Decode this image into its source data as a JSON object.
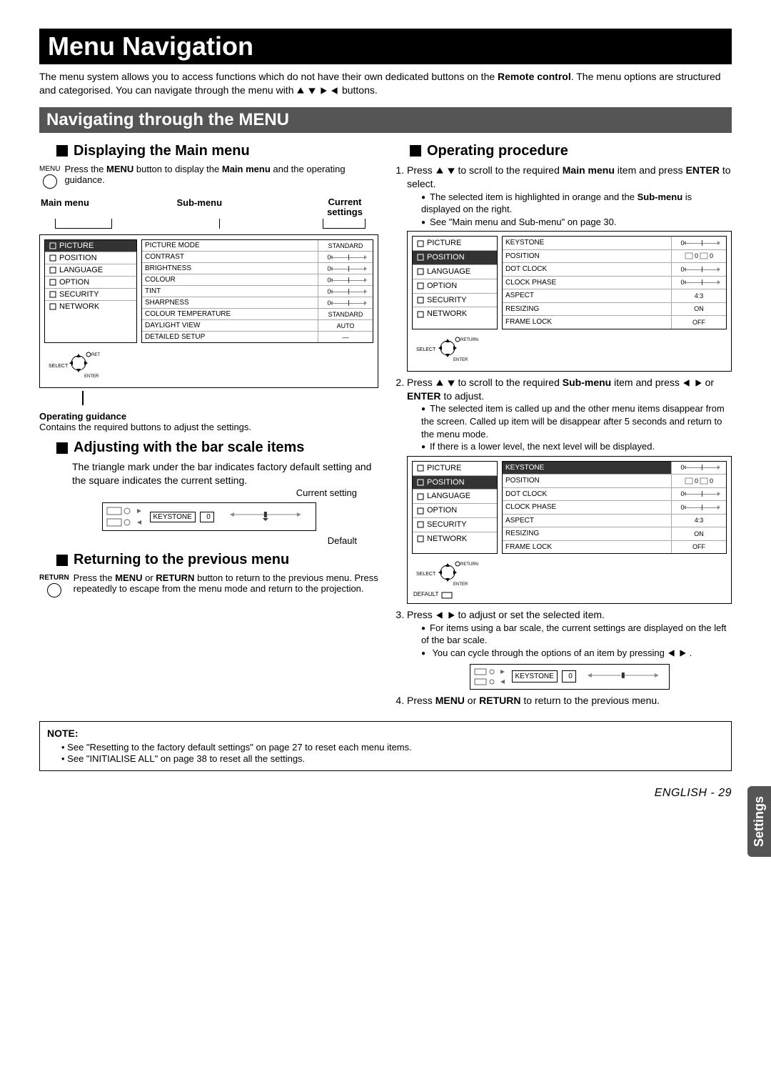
{
  "page": {
    "title": "Menu Navigation",
    "intro_part1": "The menu system allows you to access functions which do not have their own dedicated buttons on the ",
    "intro_bold1": "Remote control",
    "intro_part2": ". The menu options are structured and categorised. You can navigate through the menu with ",
    "intro_part3": " buttons.",
    "side_tab": "Settings",
    "footer": "ENGLISH - 29"
  },
  "section_bar": "Navigating through the MENU",
  "left": {
    "h_display": "Displaying the Main menu",
    "menu_btn_label": "MENU",
    "display_text_1": "Press the ",
    "display_bold_1": "MENU",
    "display_text_2": " button to display the ",
    "display_bold_2": "Main menu",
    "display_text_3": " and the operating guidance.",
    "labels": {
      "main_menu": "Main menu",
      "sub_menu": "Sub-menu",
      "current_settings": "Current settings"
    },
    "main_items": [
      "PICTURE",
      "POSITION",
      "LANGUAGE",
      "OPTION",
      "SECURITY",
      "NETWORK"
    ],
    "sub_items": [
      {
        "name": "PICTURE MODE",
        "val": "STANDARD",
        "type": "text"
      },
      {
        "name": "CONTRAST",
        "val": "0",
        "type": "bar"
      },
      {
        "name": "BRIGHTNESS",
        "val": "0",
        "type": "bar"
      },
      {
        "name": "COLOUR",
        "val": "0",
        "type": "bar"
      },
      {
        "name": "TINT",
        "val": "0",
        "type": "bar"
      },
      {
        "name": "SHARPNESS",
        "val": "0",
        "type": "bar"
      },
      {
        "name": "COLOUR TEMPERATURE",
        "val": "STANDARD",
        "type": "text"
      },
      {
        "name": "DAYLIGHT VIEW",
        "val": "AUTO",
        "type": "text"
      },
      {
        "name": "DETAILED SETUP",
        "val": "—",
        "type": "text"
      }
    ],
    "ctrl": {
      "select": "SELECT",
      "return": "RETURN",
      "enter": "ENTER"
    },
    "op_guidance_label": "Operating guidance",
    "op_guidance_text": "Contains the required buttons to adjust the settings.",
    "h_adjust": "Adjusting with the bar scale items",
    "adjust_text": "The triangle mark under the bar indicates factory default setting and the square indicates the current setting.",
    "current_setting_caption": "Current setting",
    "default_caption": "Default",
    "keystone_label": "KEYSTONE",
    "keystone_val": "0",
    "h_return": "Returning to the previous menu",
    "return_btn_label": "RETURN",
    "return_text_1": "Press the ",
    "return_bold_1": "MENU",
    "return_text_2": " or ",
    "return_bold_2": "RETURN",
    "return_text_3": " button to return to the previous menu. Press repeatedly to escape from the menu mode and return to the projection."
  },
  "right": {
    "h_op": "Operating procedure",
    "step1_a": "Press ",
    "step1_b": " to scroll to the required ",
    "step1_bold": "Main menu",
    "step1_c": " item and press ",
    "step1_bold2": "ENTER",
    "step1_d": " to select.",
    "step1_bul1_a": "The selected item is highlighted in orange and the ",
    "step1_bul1_bold": "Sub-menu",
    "step1_bul1_b": " is displayed on the right.",
    "step1_bul2": "See \"Main menu and Sub-menu\" on page 30.",
    "fig_main_items": [
      "PICTURE",
      "POSITION",
      "LANGUAGE",
      "OPTION",
      "SECURITY",
      "NETWORK"
    ],
    "fig_selected": "POSITION",
    "fig_sub_items": [
      {
        "name": "KEYSTONE",
        "val": "0",
        "type": "bar"
      },
      {
        "name": "POSITION",
        "val": "0",
        "type": "pos"
      },
      {
        "name": "DOT CLOCK",
        "val": "0",
        "type": "bar"
      },
      {
        "name": "CLOCK PHASE",
        "val": "0",
        "type": "bar"
      },
      {
        "name": "ASPECT",
        "val": "4:3",
        "type": "text"
      },
      {
        "name": "RESIZING",
        "val": "ON",
        "type": "text"
      },
      {
        "name": "FRAME LOCK",
        "val": "OFF",
        "type": "text"
      }
    ],
    "step2_a": "Press ",
    "step2_b": " to scroll to the required ",
    "step2_bold": "Sub-menu",
    "step2_c": " item and press ",
    "step2_d": " or ",
    "step2_bold2": "ENTER",
    "step2_e": " to adjust.",
    "step2_bul1": "The selected item is called up and the other menu items disappear from the screen. Called up item will be disappear after 5 seconds and return to the menu mode.",
    "step2_bul2": "If there is a lower level, the next level will be displayed.",
    "fig2_sub_selected": "KEYSTONE",
    "default_label": "DEFAULT",
    "step3_a": "Press ",
    "step3_b": " to adjust or set the selected item.",
    "step3_bul1": "For items using a bar scale, the current settings are displayed on the left of the bar scale.",
    "step3_bul2_a": "You can cycle through the options of an item by pressing ",
    "step3_bul2_b": ".",
    "step4_a": "Press ",
    "step4_bold1": "MENU",
    "step4_b": " or ",
    "step4_bold2": "RETURN",
    "step4_c": " to return to the previous menu."
  },
  "note": {
    "heading": "NOTE:",
    "items": [
      "See \"Resetting to the factory default settings\" on page 27 to reset each menu items.",
      "See \"INITIALISE ALL\" on page 38 to reset all the settings."
    ]
  }
}
